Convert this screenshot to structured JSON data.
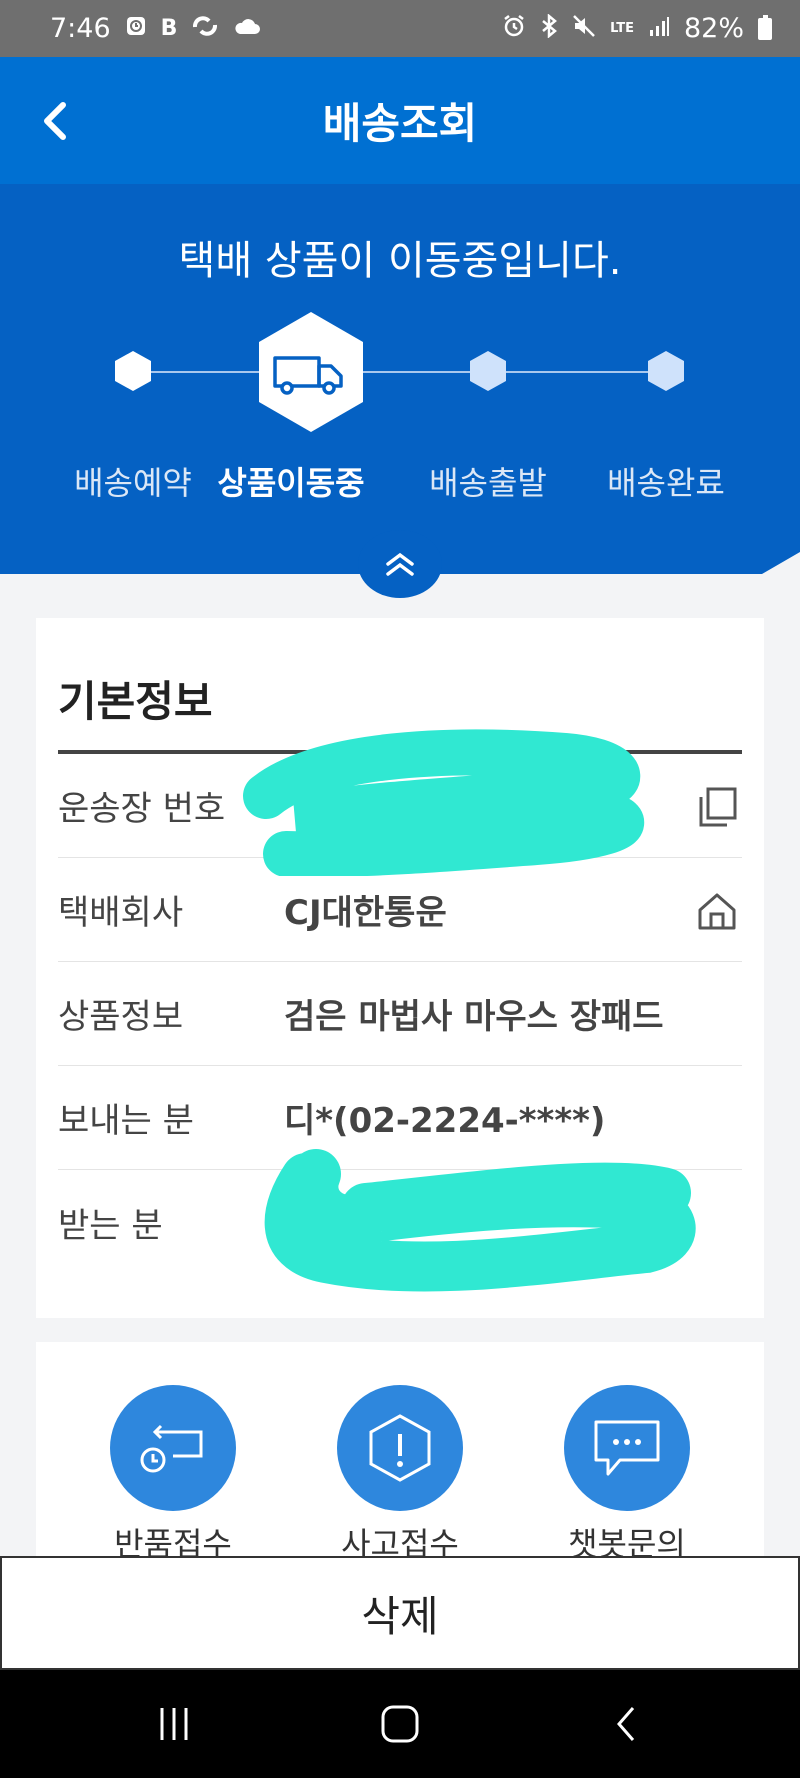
{
  "status_bar": {
    "time": "7:46",
    "left_icons": [
      "alarm-clock-app-icon",
      "b-app-icon",
      "swirl-app-icon",
      "cloud-icon"
    ],
    "right_icons": [
      "alarm-icon",
      "bluetooth-icon",
      "mute-icon",
      "lte-icon",
      "signal-icon",
      "battery-icon"
    ],
    "lte_label": "LTE",
    "battery": "82%"
  },
  "header": {
    "title": "배송조회",
    "back_icon": "chevron-left-icon"
  },
  "tracking": {
    "message": "택배 상품이 이동중입니다.",
    "steps": [
      {
        "label": "배송예약",
        "active": false
      },
      {
        "label": "상품이동중",
        "active": true
      },
      {
        "label": "배송출발",
        "active": false
      },
      {
        "label": "배송완료",
        "active": false
      }
    ],
    "active_step_icon": "truck-icon",
    "collapse_icon": "double-chevron-up-icon",
    "accent": "#0070d2",
    "hero_bg": "#0561c3"
  },
  "basic_info": {
    "title": "기본정보",
    "rows": [
      {
        "label": "운송장 번호",
        "value": "",
        "icon": "copy-icon",
        "redacted": true
      },
      {
        "label": "택배회사",
        "value": "CJ대한통운",
        "icon": "home-icon"
      },
      {
        "label": "상품정보",
        "value": "검은 마법사 마우스 장패드"
      },
      {
        "label": "보내는 분",
        "value": "디*(02-2224-****)"
      },
      {
        "label": "받는 분",
        "value": "",
        "redacted": true
      }
    ],
    "redaction_color": "#30e8d2"
  },
  "actions": [
    {
      "label": "반품접수",
      "icon": "return-request-icon"
    },
    {
      "label": "사고접수",
      "icon": "accident-report-icon"
    },
    {
      "label": "챗봇문의",
      "icon": "chatbot-icon"
    }
  ],
  "delete_button": {
    "label": "삭제"
  },
  "nav": {
    "recent_icon": "recent-apps-icon",
    "home_icon": "home-nav-icon",
    "back_icon": "back-nav-icon"
  }
}
